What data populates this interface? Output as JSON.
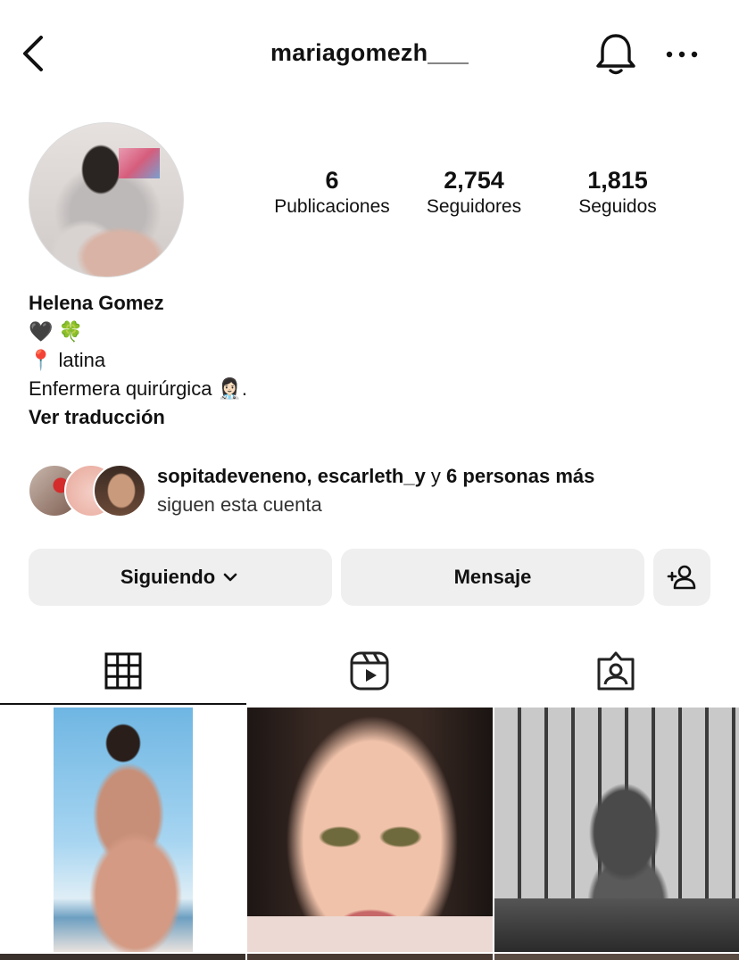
{
  "header": {
    "username": "mariagomezh___"
  },
  "profile": {
    "stats": [
      {
        "value": "6",
        "label": "Publicaciones"
      },
      {
        "value": "2,754",
        "label": "Seguidores"
      },
      {
        "value": "1,815",
        "label": "Seguidos"
      }
    ],
    "name": "Helena Gomez",
    "bio_lines": [
      "🖤 🍀",
      "📍 latina",
      "Enfermera quirúrgica 👩🏻‍⚕️."
    ],
    "translate_link": "Ver traducción"
  },
  "followed_by": {
    "user1": "sopitadeveneno",
    "separator": ", ",
    "user2": "escarleth_y",
    "connector": " y ",
    "others": "6 personas más",
    "subtitle": "siguen esta cuenta"
  },
  "actions": {
    "following_label": "Siguiendo",
    "message_label": "Mensaje"
  },
  "tabs": [
    {
      "icon": "grid-icon",
      "active": true
    },
    {
      "icon": "reels-icon",
      "active": false
    },
    {
      "icon": "tagged-icon",
      "active": false
    }
  ],
  "icons": {
    "back": "chevron-left-icon",
    "notifications": "bell-icon",
    "more": "more-horizontal-icon",
    "add_person": "add-person-icon"
  }
}
